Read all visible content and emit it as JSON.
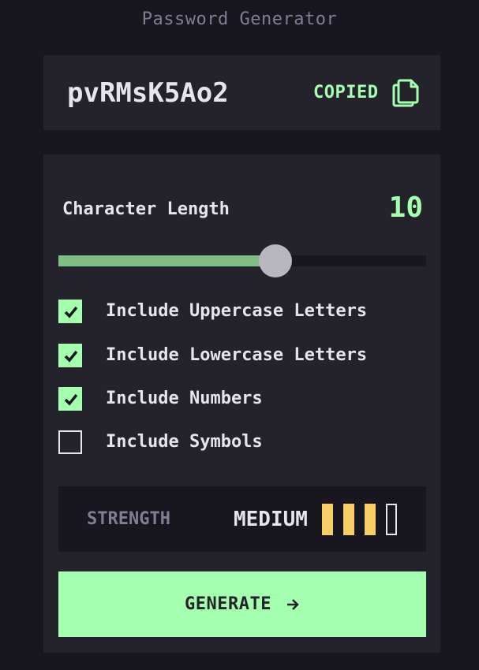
{
  "app": {
    "title": "Password Generator"
  },
  "output": {
    "password": "pvRMsK5Ao2",
    "copied_label": "COPIED",
    "copy_icon": "copy-icon"
  },
  "length": {
    "label": "Character Length",
    "value": "10",
    "slider_fraction": 0.59
  },
  "options": [
    {
      "label": "Include Uppercase Letters",
      "checked": true
    },
    {
      "label": "Include Lowercase Letters",
      "checked": true
    },
    {
      "label": "Include Numbers",
      "checked": true
    },
    {
      "label": "Include Symbols",
      "checked": false
    }
  ],
  "strength": {
    "label": "STRENGTH",
    "value": "MEDIUM",
    "level": 3,
    "max_level": 4
  },
  "generate": {
    "label": "GENERATE",
    "icon": "arrow-right-icon"
  },
  "colors": {
    "accent": "#a4ffaf",
    "medium_strength": "#f8cd65",
    "background": "#18171f",
    "panel": "#24232c"
  }
}
